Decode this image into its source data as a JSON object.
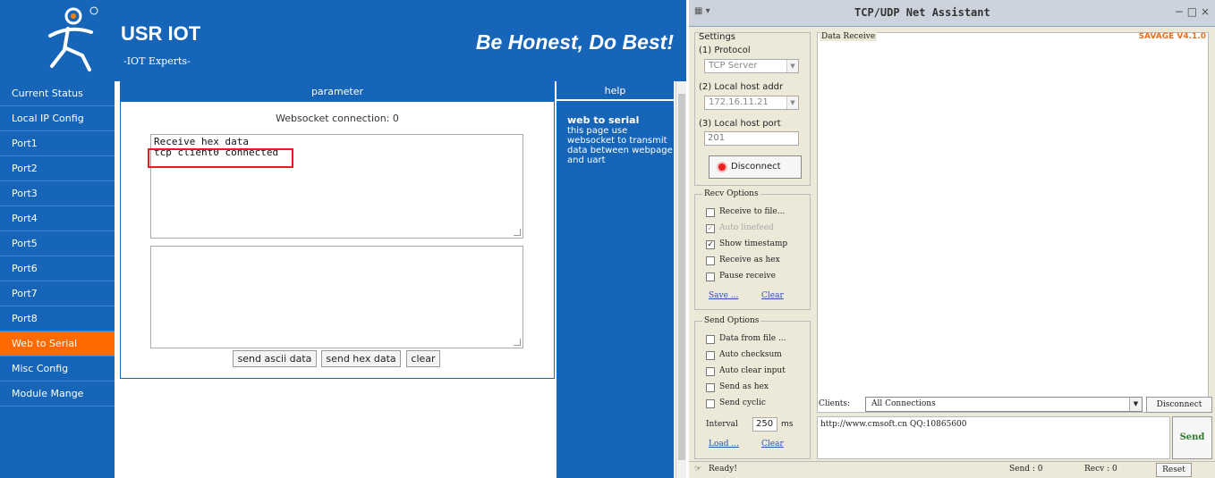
{
  "web": {
    "brand": "USR IOT",
    "brand_sub": "-IOT Experts-",
    "motto": "Be Honest, Do Best!",
    "nav": [
      {
        "label": "Current Status",
        "active": false
      },
      {
        "label": "Local IP Config",
        "active": false
      },
      {
        "label": "Port1",
        "active": false
      },
      {
        "label": "Port2",
        "active": false
      },
      {
        "label": "Port3",
        "active": false
      },
      {
        "label": "Port4",
        "active": false
      },
      {
        "label": "Port5",
        "active": false
      },
      {
        "label": "Port6",
        "active": false
      },
      {
        "label": "Port7",
        "active": false
      },
      {
        "label": "Port8",
        "active": false
      },
      {
        "label": "Web to Serial",
        "active": true
      },
      {
        "label": "Misc Config",
        "active": false
      },
      {
        "label": "Module Mange",
        "active": false
      }
    ],
    "param_header": "parameter",
    "ws_status": "Websocket connection: 0",
    "receive_lines": [
      "Receive hex data",
      "tcp client0 connected"
    ],
    "send_ascii": "send ascii data",
    "send_hex": "send hex data",
    "clear": "clear",
    "help_header": "help",
    "help_title": "web to serial",
    "help_text": "this page use websocket to transmit data between webpage and uart"
  },
  "tool": {
    "title": "TCP/UDP Net Assistant",
    "version": "SAVAGE V4.1.0",
    "window_controls": "− □ ×",
    "settings_label": "Settings",
    "protocol_label": "(1) Protocol",
    "protocol_value": "TCP Server",
    "host_addr_label": "(2) Local host addr",
    "host_addr_value": "172.16.11.21",
    "host_port_label": "(3) Local host port",
    "host_port_value": "201",
    "disconnect_label": "Disconnect",
    "recv_options_label": "Recv Options",
    "recv_options": [
      {
        "label": "Receive to file...",
        "checked": false,
        "disabled": false
      },
      {
        "label": "Auto linefeed",
        "checked": true,
        "disabled": true
      },
      {
        "label": "Show timestamp",
        "checked": true,
        "disabled": false
      },
      {
        "label": "Receive as hex",
        "checked": false,
        "disabled": false
      },
      {
        "label": "Pause receive",
        "checked": false,
        "disabled": false
      }
    ],
    "recv_save": "Save ...",
    "recv_clear": "Clear",
    "send_options_label": "Send Options",
    "send_options": [
      {
        "label": "Data from file ...",
        "checked": false
      },
      {
        "label": "Auto checksum",
        "checked": false
      },
      {
        "label": "Auto clear input",
        "checked": false
      },
      {
        "label": "Send as hex",
        "checked": false
      },
      {
        "label": "Send cyclic",
        "checked": false
      }
    ],
    "interval_label": "Interval",
    "interval_value": "250",
    "interval_unit": "ms",
    "send_load": "Load ...",
    "send_clear": "Clear",
    "data_receive_label": "Data Receive",
    "clients_label": "Clients:",
    "clients_value": "All Connections",
    "clients_disconnect": "Disconnect",
    "send_text": "http://www.cmsoft.cn QQ:10865600",
    "send_button": "Send",
    "status_ready": "Ready!",
    "send_count": "Send : 0",
    "recv_count": "Recv : 0",
    "reset_button": "Reset"
  },
  "colors": {
    "web_blue": "#1665b8",
    "active_orange": "#ff6a00",
    "highlight_red": "#e02020",
    "version_orange": "#e87020"
  }
}
